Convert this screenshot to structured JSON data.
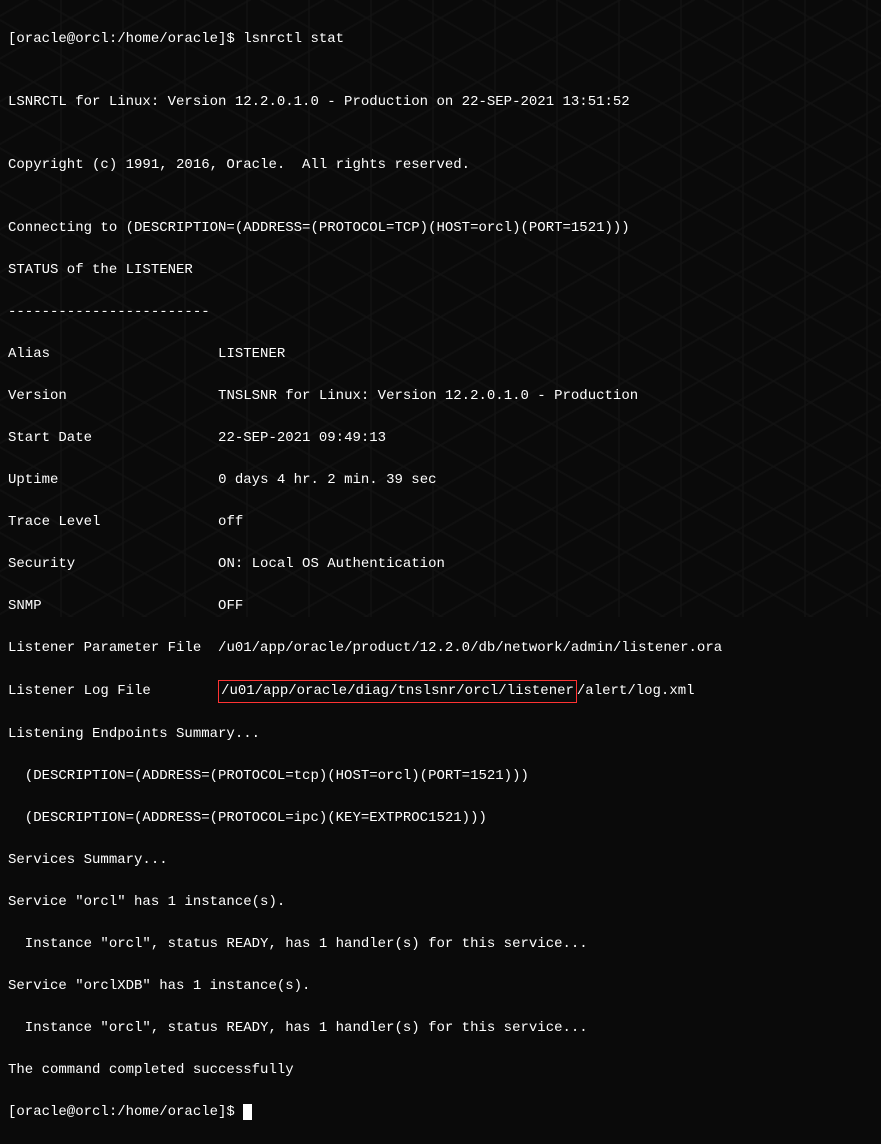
{
  "prompt1": "[oracle@orcl:/home/oracle]$ ",
  "command": "lsnrctl stat",
  "blank": "",
  "line1": "LSNRCTL for Linux: Version 12.2.0.1.0 - Production on 22-SEP-2021 13:51:52",
  "line2": "Copyright (c) 1991, 2016, Oracle.  All rights reserved.",
  "line3": "Connecting to (DESCRIPTION=(ADDRESS=(PROTOCOL=TCP)(HOST=orcl)(PORT=1521)))",
  "line4": "STATUS of the LISTENER",
  "line5": "------------------------",
  "alias_label": "Alias",
  "alias_value": "LISTENER",
  "version_label": "Version",
  "version_value": "TNSLSNR for Linux: Version 12.2.0.1.0 - Production",
  "start_label": "Start Date",
  "start_value": "22-SEP-2021 09:49:13",
  "uptime_label": "Uptime",
  "uptime_value": "0 days 4 hr. 2 min. 39 sec",
  "trace_label": "Trace Level",
  "trace_value": "off",
  "security_label": "Security",
  "security_value": "ON: Local OS Authentication",
  "snmp_label": "SNMP",
  "snmp_value": "OFF",
  "param_label": "Listener Parameter File",
  "param_value": "/u01/app/oracle/product/12.2.0/db/network/admin/listener.ora",
  "log_label": "Listener Log File",
  "log_path_highlighted": "/u01/app/oracle/diag/tnslsnr/orcl/listener",
  "log_path_rest": "/alert/log.xml",
  "line6": "Listening Endpoints Summary...",
  "line7": "  (DESCRIPTION=(ADDRESS=(PROTOCOL=tcp)(HOST=orcl)(PORT=1521)))",
  "line8": "  (DESCRIPTION=(ADDRESS=(PROTOCOL=ipc)(KEY=EXTPROC1521)))",
  "line9": "Services Summary...",
  "line10": "Service \"orcl\" has 1 instance(s).",
  "line11": "  Instance \"orcl\", status READY, has 1 handler(s) for this service...",
  "line12": "Service \"orclXDB\" has 1 instance(s).",
  "line13": "  Instance \"orcl\", status READY, has 1 handler(s) for this service...",
  "line14": "The command completed successfully",
  "prompt2": "[oracle@orcl:/home/oracle]$ ",
  "pad": "                         ",
  "pad_short": "         ",
  "pad_log": "         "
}
